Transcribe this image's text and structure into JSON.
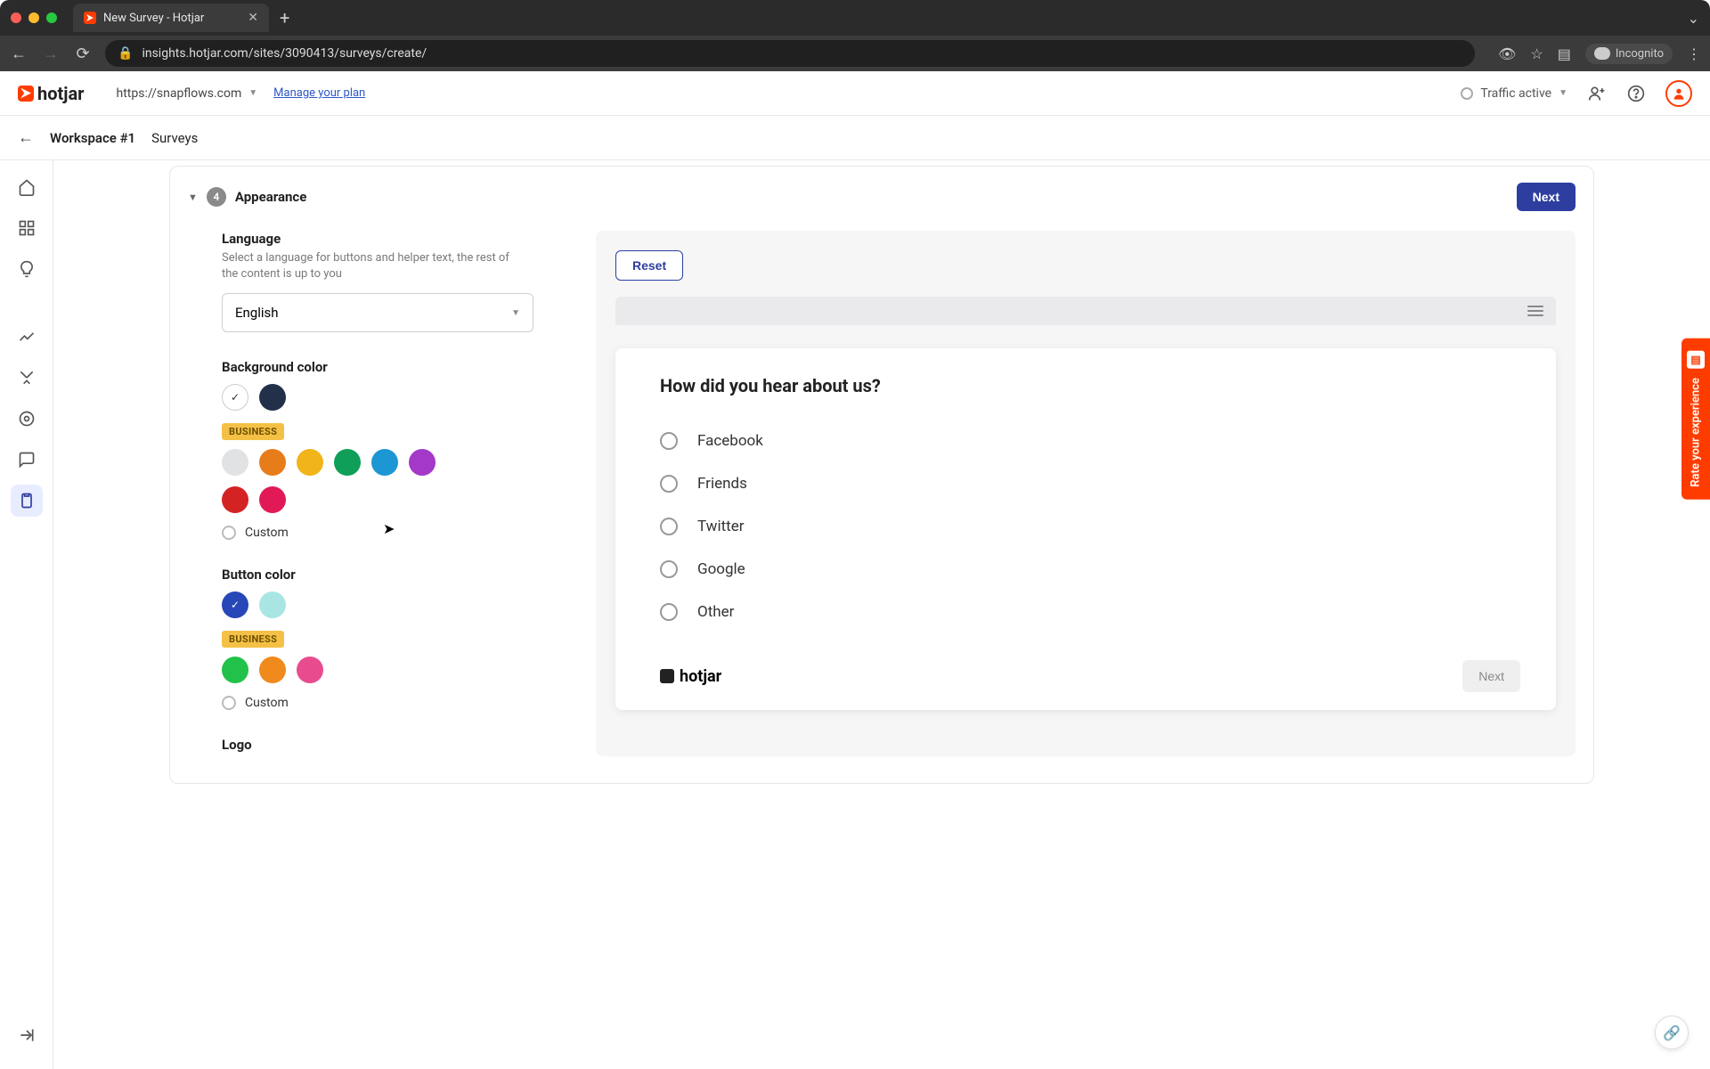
{
  "browser": {
    "tab_title": "New Survey - Hotjar",
    "url": "insights.hotjar.com/sites/3090413/surveys/create/",
    "incognito_label": "Incognito"
  },
  "header": {
    "brand": "hotjar",
    "site_url": "https://snapflows.com",
    "manage_plan": "Manage your plan",
    "traffic_label": "Traffic active"
  },
  "breadcrumb": {
    "workspace": "Workspace #1",
    "section": "Surveys"
  },
  "panel": {
    "step_number": "4",
    "title": "Appearance",
    "next_label": "Next",
    "reset_label": "Reset"
  },
  "language": {
    "label": "Language",
    "desc": "Select a language for buttons and helper text, the rest of the content is up to you",
    "selected": "English"
  },
  "background": {
    "label": "Background color",
    "business_badge": "BUSINESS",
    "custom_label": "Custom",
    "free_colors": [
      {
        "hex": "#ffffff",
        "selected": true
      },
      {
        "hex": "#22304a",
        "selected": false
      }
    ],
    "business_colors": [
      "#e1e2e3",
      "#e77c1b",
      "#f1b41a",
      "#0f9f58",
      "#1d96d4",
      "#a438c9",
      "#d42323",
      "#e11a57"
    ]
  },
  "button_color": {
    "label": "Button color",
    "business_badge": "BUSINESS",
    "custom_label": "Custom",
    "free_colors": [
      {
        "hex": "#2746b7",
        "selected": true
      },
      {
        "hex": "#a9e6e3",
        "selected": false
      }
    ],
    "business_colors": [
      "#22c24a",
      "#f08a1d",
      "#e94b8f"
    ]
  },
  "logo_section": {
    "label": "Logo"
  },
  "preview": {
    "question": "How did you hear about us?",
    "options": [
      "Facebook",
      "Friends",
      "Twitter",
      "Google",
      "Other"
    ],
    "next_label": "Next",
    "brand": "hotjar"
  },
  "rate_tab": "Rate your experience"
}
